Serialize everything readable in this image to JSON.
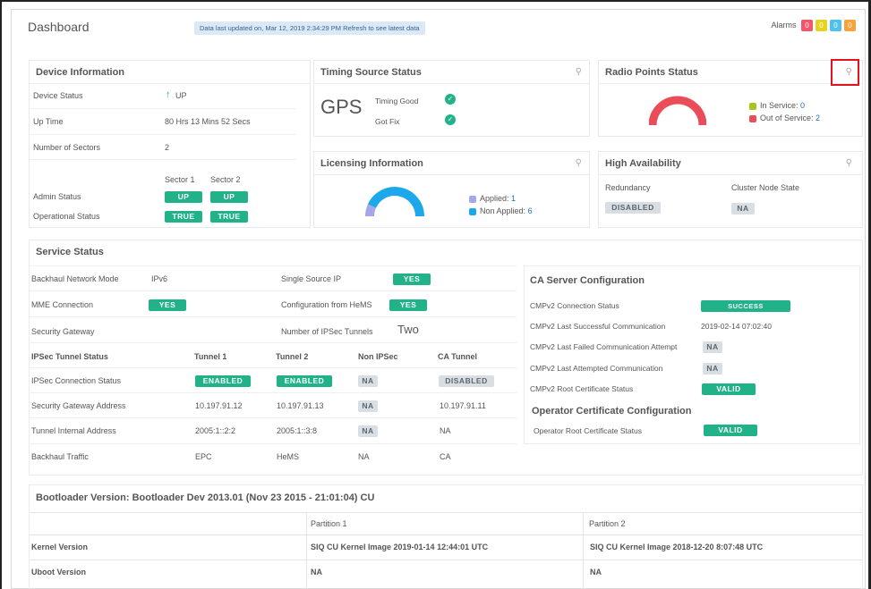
{
  "header": {
    "title": "Dashboard",
    "banner": "Data last updated on, Mar 12, 2019 2:34:29 PM Refresh to see latest data",
    "alarms_label": "Alarms",
    "alarms": [
      {
        "count": "0",
        "color": "#f2566a"
      },
      {
        "count": "0",
        "color": "#e9d21d"
      },
      {
        "count": "0",
        "color": "#4fc1ea"
      },
      {
        "count": "0",
        "color": "#f6a43a"
      }
    ]
  },
  "device_info": {
    "title": "Device Information",
    "status_label": "Device Status",
    "status_value": "UP",
    "uptime_label": "Up Time",
    "uptime_value": "80 Hrs 13 Mins 52 Secs",
    "sectors_label": "Number of Sectors",
    "sectors_value": "2",
    "sector1": "Sector 1",
    "sector2": "Sector 2",
    "admin_label": "Admin Status",
    "admin_s1": "UP",
    "admin_s2": "UP",
    "oper_label": "Operational Status",
    "oper_s1": "TRUE",
    "oper_s2": "TRUE"
  },
  "timing": {
    "title": "Timing Source Status",
    "source": "GPS",
    "timing_good": "Timing Good",
    "got_fix": "Got Fix"
  },
  "radio": {
    "title": "Radio Points Status",
    "in_service_label": "In Service:",
    "in_service_value": "0",
    "out_service_label": "Out of Service:",
    "out_service_value": "2",
    "in_color": "#a5c718",
    "out_color": "#ea4c59"
  },
  "licensing": {
    "title": "Licensing Information",
    "applied_label": "Applied:",
    "applied_value": "1",
    "non_applied_label": "Non Applied:",
    "non_applied_value": "6",
    "applied_color": "#a6a7e8",
    "non_applied_color": "#1ca8ea"
  },
  "ha": {
    "title": "High Availability",
    "redundancy_label": "Redundancy",
    "cluster_label": "Cluster Node State",
    "redundancy_value": "DISABLED",
    "cluster_value": "NA"
  },
  "service": {
    "title": "Service Status",
    "backhaul_label": "Backhaul Network Mode",
    "backhaul_value": "IPv6",
    "single_source_label": "Single Source IP",
    "single_source_value": "YES",
    "mme_label": "MME Connection",
    "mme_value": "YES",
    "hems_label": "Configuration from HeMS",
    "hems_value": "YES",
    "secgw_label": "Security Gateway",
    "tunnels_label": "Number of IPSec Tunnels",
    "tunnels_value": "Two",
    "tunnel_headers": [
      "IPSec Tunnel Status",
      "Tunnel 1",
      "Tunnel 2",
      "Non IPSec",
      "CA Tunnel"
    ],
    "tunnel_rows": [
      {
        "label": "IPSec Connection Status",
        "t1": "ENABLED",
        "t2": "ENABLED",
        "non": "NA",
        "ca": "DISABLED"
      },
      {
        "label": "Security Gateway Address",
        "t1": "10.197.91.12",
        "t2": "10.197.91.13",
        "non": "NA",
        "ca": "10.197.91.11"
      },
      {
        "label": "Tunnel Internal Address",
        "t1": "2005:1::2:2",
        "t2": "2005:1::3:8",
        "non": "NA",
        "ca": "NA"
      },
      {
        "label": "Backhaul Traffic",
        "t1": "EPC",
        "t2": "HeMS",
        "non": "NA",
        "ca": "CA"
      }
    ]
  },
  "ca_server": {
    "title": "CA Server Configuration",
    "rows": [
      {
        "label": "CMPv2 Connection Status",
        "value": "SUCCESS"
      },
      {
        "label": "CMPv2 Last Successful Communication",
        "value": "2019-02-14 07:02:40"
      },
      {
        "label": "CMPv2 Last Failed Communication Attempt",
        "value": "NA"
      },
      {
        "label": "CMPv2 Last Attempted Communication",
        "value": "NA"
      },
      {
        "label": "CMPv2 Root Certificate Status",
        "value": "VALID"
      }
    ],
    "operator_title": "Operator Certificate Configuration",
    "operator_label": "Operator Root Certificate Status",
    "operator_value": "VALID"
  },
  "bootloader": {
    "title": "Bootloader Version: Bootloader Dev 2013.01 (Nov 23 2015 - 21:01:04) CU",
    "partition1": "Partition 1",
    "partition2": "Partition 2",
    "kernel_label": "Kernel Version",
    "kernel_p1": "SIQ CU Kernel Image 2019-01-14 12:44:01 UTC",
    "kernel_p2": "SIQ CU Kernel Image 2018-12-20 8:07:48 UTC",
    "uboot_label": "Uboot Version",
    "uboot_p1": "NA",
    "uboot_p2": "NA"
  }
}
